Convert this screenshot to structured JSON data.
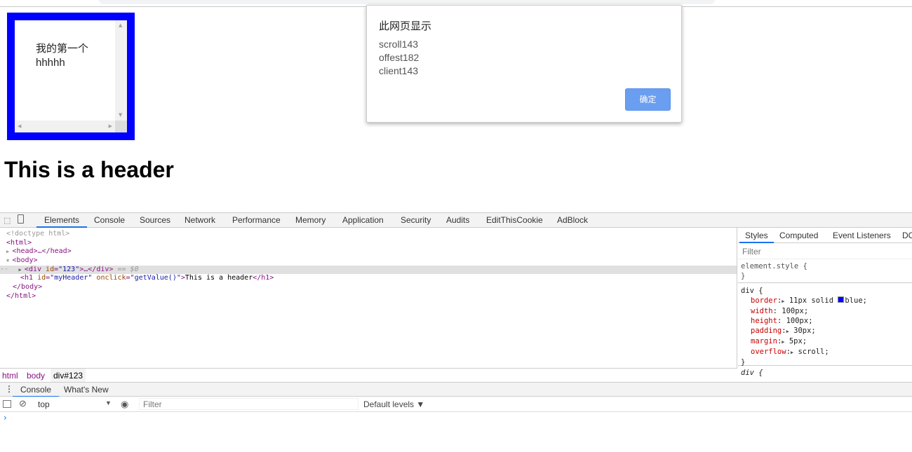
{
  "page": {
    "box_text_line1": "我的第一个",
    "box_text_line2": "hhhhh",
    "header": "This is a header",
    "box_border_color": "#0000ff"
  },
  "dialog": {
    "title": "此网页显示",
    "lines": [
      "scroll143",
      "offest182",
      "client143"
    ],
    "ok_label": "确定",
    "button_color": "#6a9ef0"
  },
  "devtools": {
    "tabs": [
      "Elements",
      "Console",
      "Sources",
      "Network",
      "Performance",
      "Memory",
      "Application",
      "Security",
      "Audits",
      "EditThisCookie",
      "AdBlock"
    ],
    "active_tab": "Elements",
    "dom": {
      "doctype": "<!doctype html>",
      "html_open": "<html>",
      "head": "<head>…</head>",
      "body_open": "<body>",
      "div_tag": "div",
      "div_attr": "id",
      "div_val": "\"123\"",
      "div_tail": ">…</div>",
      "selected_marker": "== $0",
      "h1_id_val": "\"myHeader\"",
      "h1_onclick_val": "\"getValue()\"",
      "h1_text": "This is a header",
      "body_close": "</body>",
      "html_close": "</html>"
    },
    "styles": {
      "tabs": [
        "Styles",
        "Computed",
        "Event Listeners",
        "DC"
      ],
      "filter_placeholder": "Filter",
      "element_style": "element.style {",
      "close": "}",
      "rule_selector": "div {",
      "props": [
        {
          "name": "border",
          "value": "11px solid ",
          "extra": "blue;",
          "expand": true
        },
        {
          "name": "width",
          "value": "100px;",
          "expand": false
        },
        {
          "name": "height",
          "value": "100px;",
          "expand": false
        },
        {
          "name": "padding",
          "value": "30px;",
          "expand": true
        },
        {
          "name": "margin",
          "value": "5px;",
          "expand": true
        },
        {
          "name": "overflow",
          "value": "scroll;",
          "expand": true
        }
      ],
      "next_rule": "div {"
    },
    "breadcrumb": [
      "html",
      "body",
      "div#123"
    ],
    "drawer_tabs": [
      "Console",
      "What's New"
    ],
    "console": {
      "context": "top",
      "filter_placeholder": "Filter",
      "levels": "Default levels ▼",
      "prompt": "›"
    }
  }
}
